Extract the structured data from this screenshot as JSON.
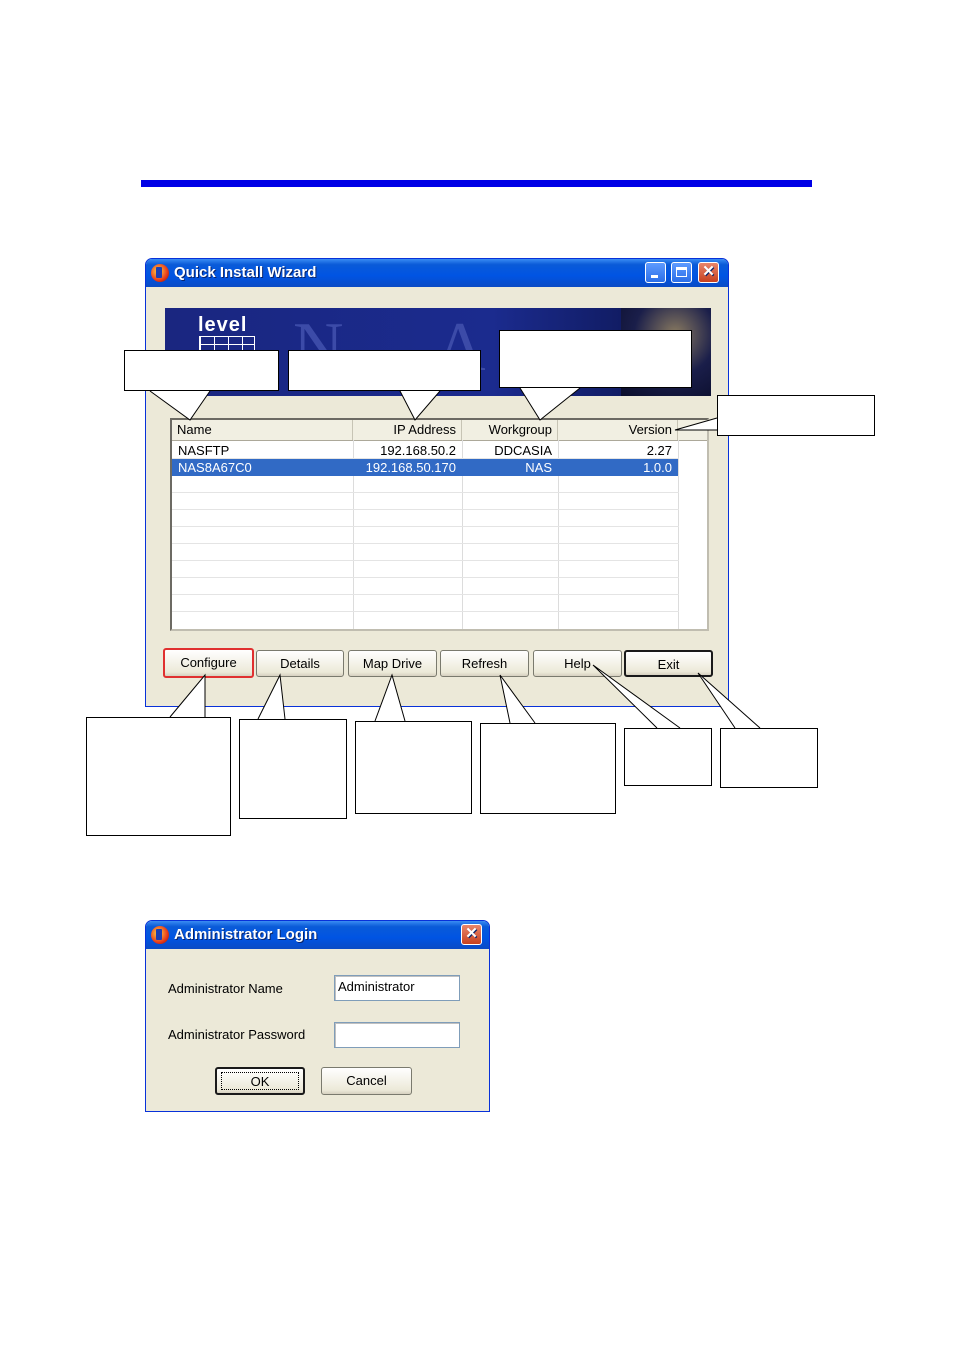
{
  "wizard": {
    "title": "Quick Install Wizard",
    "banner": {
      "logo_text": "level",
      "letters": [
        "N",
        "A"
      ]
    },
    "columns": [
      "Name",
      "IP Address",
      "Workgroup",
      "Version"
    ],
    "rows": [
      {
        "name": "NASFTP",
        "ip": "192.168.50.2",
        "workgroup": "DDCASIA",
        "version": "2.27",
        "selected": false
      },
      {
        "name": "NAS8A67C0",
        "ip": "192.168.50.170",
        "workgroup": "NAS",
        "version": "1.0.0",
        "selected": true
      }
    ],
    "buttons": {
      "configure": "Configure",
      "details": "Details",
      "map_drive": "Map Drive",
      "refresh": "Refresh",
      "help": "Help",
      "exit": "Exit"
    }
  },
  "login": {
    "title": "Administrator Login",
    "name_label": "Administrator Name",
    "name_value": "Administrator",
    "password_label": "Administrator Password",
    "password_value": "",
    "ok_label": "OK",
    "cancel_label": "Cancel"
  },
  "colors": {
    "rule": "#0000e6",
    "titlebar": "#0054e3",
    "selection": "#316ac5",
    "highlight": "#e03030"
  },
  "icons": {
    "app": "app-logo-icon",
    "minimize": "minimize-icon",
    "maximize": "maximize-icon",
    "close": "close-icon"
  }
}
